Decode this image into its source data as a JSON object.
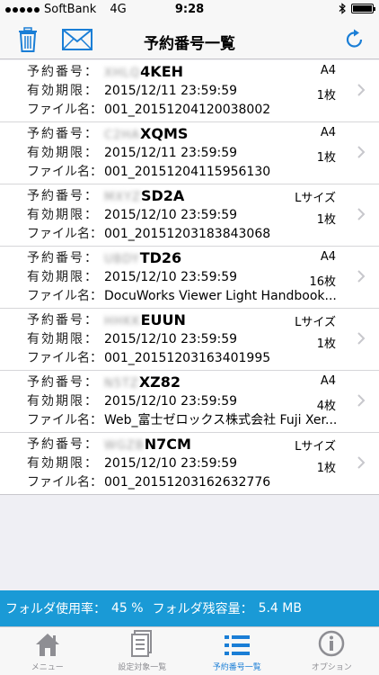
{
  "status": {
    "carrier": "SoftBank",
    "network": "4G",
    "time": "9:28"
  },
  "nav": {
    "title": "予約番号一覧"
  },
  "labels": {
    "reservation": "予約番号：",
    "expiry": "有効期限：",
    "filename": "ファイル名："
  },
  "items": [
    {
      "code_hidden": "XHLQ",
      "code_visible": "4KEH",
      "expiry": "2015/12/11 23:59:59",
      "file": "001_20151204120038002",
      "size": "A4",
      "count": "1枚"
    },
    {
      "code_hidden": "C2HA",
      "code_visible": "XQMS",
      "expiry": "2015/12/11 23:59:59",
      "file": "001_20151204115956130",
      "size": "A4",
      "count": "1枚"
    },
    {
      "code_hidden": "MXYZ",
      "code_visible": "SD2A",
      "expiry": "2015/12/10 23:59:59",
      "file": "001_20151203183843068",
      "size": "Lサイズ",
      "count": "1枚"
    },
    {
      "code_hidden": "UBDY",
      "code_visible": "TD26",
      "expiry": "2015/12/10 23:59:59",
      "file": "DocuWorks Viewer Light Handbook...",
      "size": "A4",
      "count": "16枚"
    },
    {
      "code_hidden": "HHKK",
      "code_visible": "EUUN",
      "expiry": "2015/12/10 23:59:59",
      "file": "001_20151203163401995",
      "size": "Lサイズ",
      "count": "1枚"
    },
    {
      "code_hidden": "N5TZ",
      "code_visible": "XZ82",
      "expiry": "2015/12/10 23:59:59",
      "file": "Web_富士ゼロックス株式会社 Fuji Xer...",
      "size": "A4",
      "count": "4枚"
    },
    {
      "code_hidden": "WGZB",
      "code_visible": "N7CM",
      "expiry": "2015/12/10 23:59:59",
      "file": "001_20151203162632776",
      "size": "Lサイズ",
      "count": "1枚"
    }
  ],
  "footer": {
    "usage_label": "フォルダ使用率：",
    "usage_value": "45 %",
    "remain_label": "フォルダ残容量：",
    "remain_value": "5.4 MB"
  },
  "tabs": [
    {
      "label": "メニュー",
      "icon": "home-icon"
    },
    {
      "label": "設定対象一覧",
      "icon": "document-icon"
    },
    {
      "label": "予約番号一覧",
      "icon": "list-icon"
    },
    {
      "label": "オプション",
      "icon": "info-icon"
    }
  ],
  "colors": {
    "accent": "#1a7ed6",
    "footer": "#1a9ad6"
  }
}
